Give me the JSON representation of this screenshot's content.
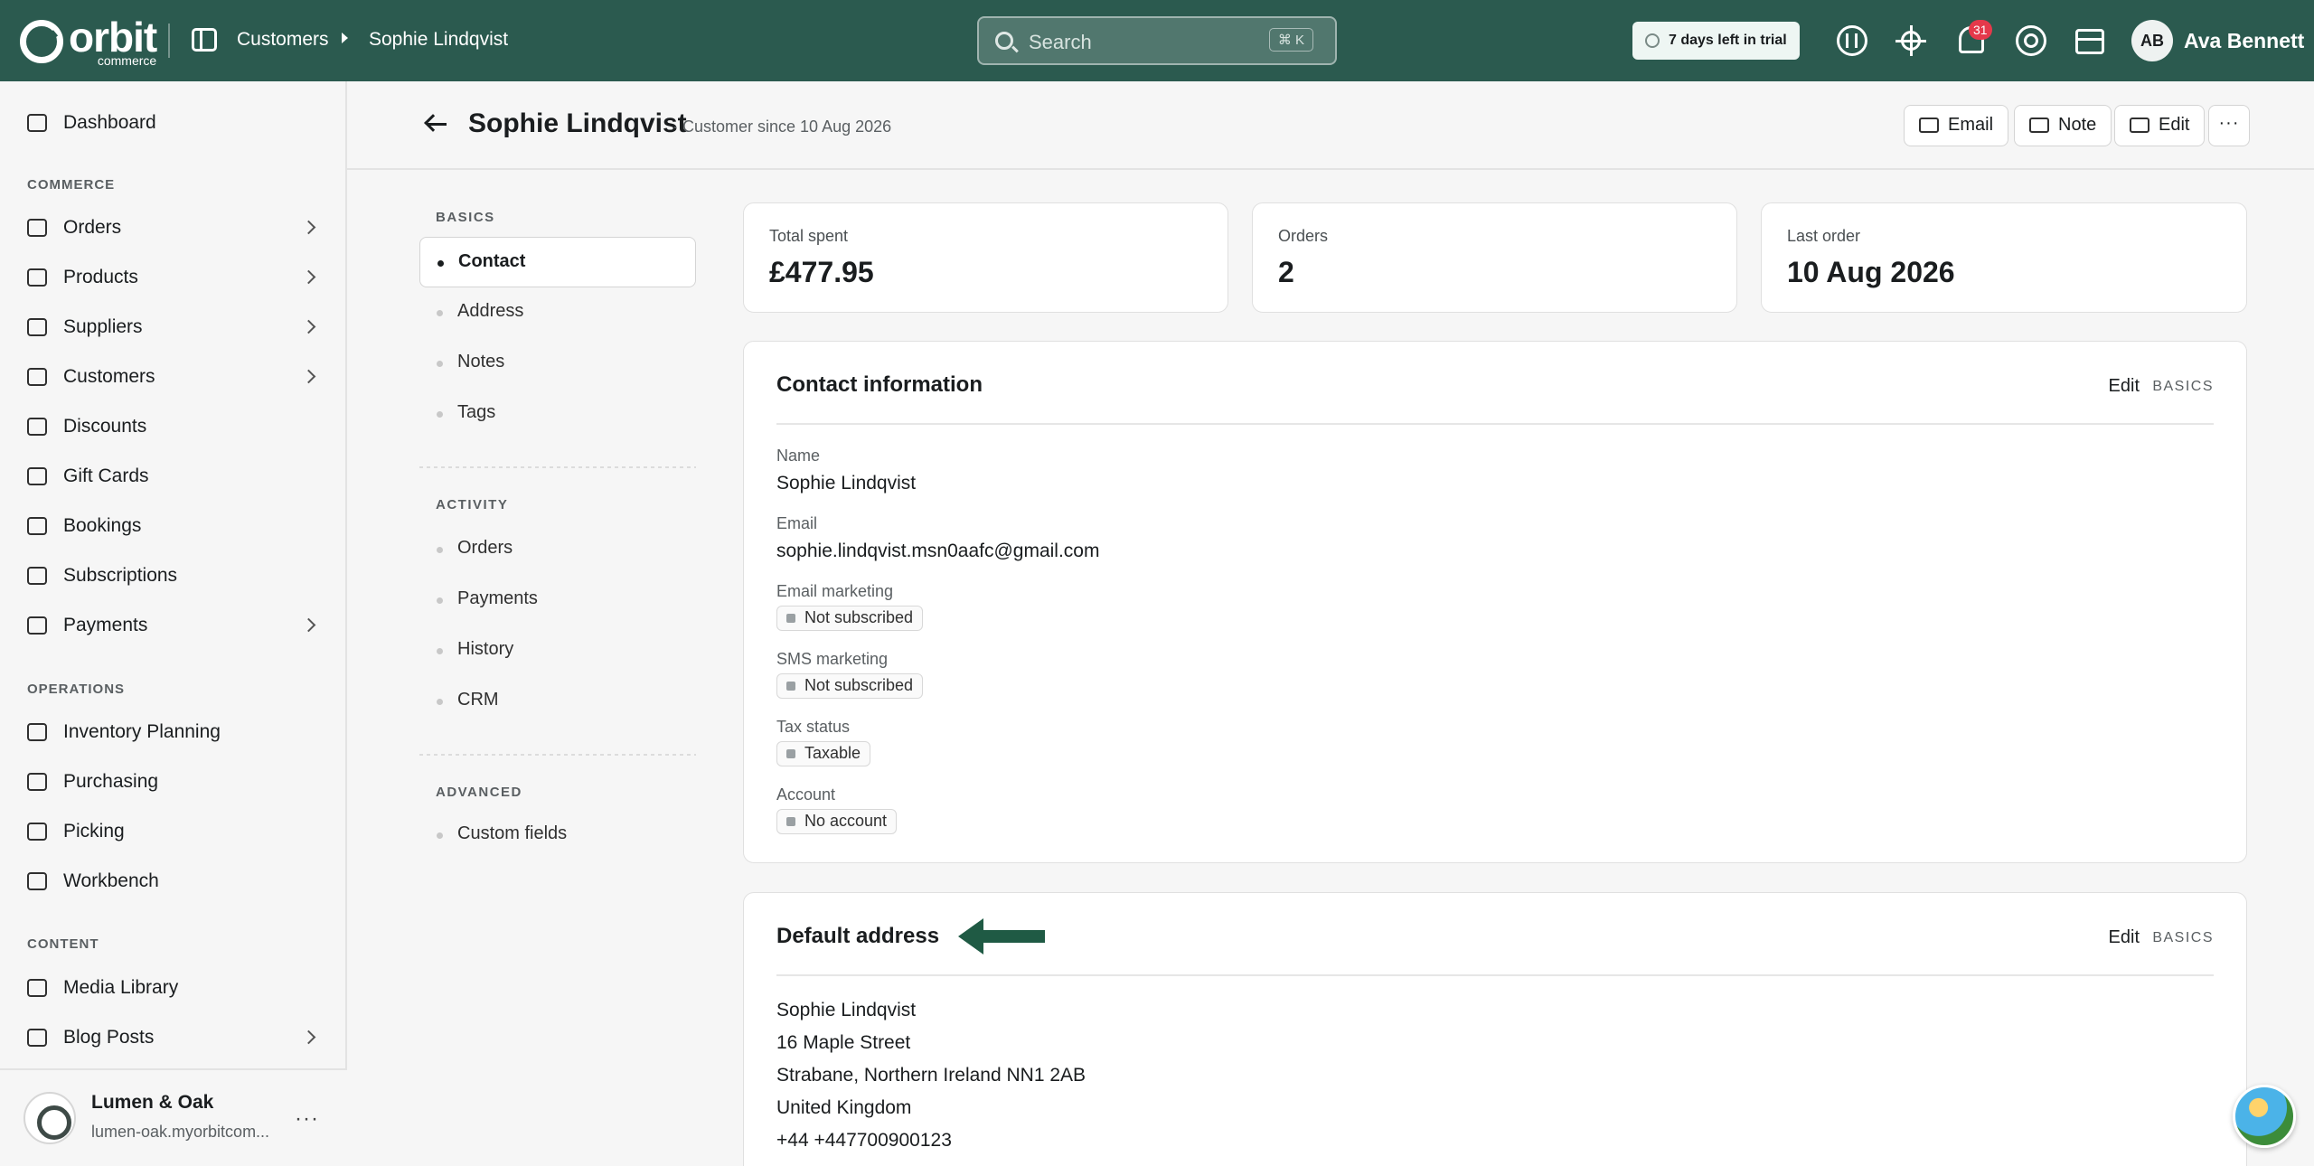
{
  "brand": {
    "name": "orbit",
    "sub": "commerce",
    "accent": "#2b5a4f"
  },
  "breadcrumb": [
    "Customers",
    "Sophie Lindqvist"
  ],
  "search": {
    "placeholder": "Search",
    "shortcut": "⌘ K"
  },
  "trial": "7 days left in trial",
  "notifications": {
    "count": "31"
  },
  "user": {
    "initials": "AB",
    "name": "Ava Bennett"
  },
  "nav": {
    "dashboard": "Dashboard",
    "commerce_heading": "COMMERCE",
    "commerce": [
      {
        "label": "Orders",
        "icon": "orders-icon",
        "chevron": true
      },
      {
        "label": "Products",
        "icon": "products-icon",
        "chevron": true
      },
      {
        "label": "Suppliers",
        "icon": "suppliers-icon",
        "chevron": true
      },
      {
        "label": "Customers",
        "icon": "customers-icon",
        "chevron": true
      },
      {
        "label": "Discounts",
        "icon": "tag-icon",
        "chevron": false
      },
      {
        "label": "Gift Cards",
        "icon": "gift-icon",
        "chevron": false
      },
      {
        "label": "Bookings",
        "icon": "calendar-icon",
        "chevron": false
      },
      {
        "label": "Subscriptions",
        "icon": "refresh-icon",
        "chevron": false
      },
      {
        "label": "Payments",
        "icon": "card-icon",
        "chevron": true
      }
    ],
    "operations_heading": "OPERATIONS",
    "operations": [
      {
        "label": "Inventory Planning",
        "icon": "clipboard-icon"
      },
      {
        "label": "Purchasing",
        "icon": "package-icon"
      },
      {
        "label": "Picking",
        "icon": "location-pin-icon"
      },
      {
        "label": "Workbench",
        "icon": "box-icon"
      }
    ],
    "content_heading": "CONTENT",
    "content": [
      {
        "label": "Media Library",
        "icon": "image-icon",
        "chevron": false
      },
      {
        "label": "Blog Posts",
        "icon": "document-icon",
        "chevron": true
      }
    ]
  },
  "store": {
    "name": "Lumen & Oak",
    "url": "lumen-oak.myorbitcom..."
  },
  "page": {
    "title": "Sophie Lindqvist",
    "subtitle": "· Customer since 10 Aug 2026",
    "actions": {
      "email": "Email",
      "note": "Note",
      "edit": "Edit",
      "more": "···"
    }
  },
  "section_nav": {
    "basics_heading": "BASICS",
    "basics": [
      "Contact",
      "Address",
      "Notes",
      "Tags"
    ],
    "activity_heading": "ACTIVITY",
    "activity": [
      "Orders",
      "Payments",
      "History",
      "CRM"
    ],
    "advanced_heading": "ADVANCED",
    "advanced": [
      "Custom fields"
    ]
  },
  "stats": [
    {
      "label": "Total spent",
      "value": "£477.95"
    },
    {
      "label": "Orders",
      "value": "2"
    },
    {
      "label": "Last order",
      "value": "10 Aug 2026"
    }
  ],
  "contact": {
    "title": "Contact information",
    "edit": "Edit",
    "tag": "BASICS",
    "name_label": "Name",
    "name": "Sophie Lindqvist",
    "email_label": "Email",
    "email": "sophie.lindqvist.msn0aafc@gmail.com",
    "email_marketing_label": "Email marketing",
    "email_marketing": "Not subscribed",
    "sms_marketing_label": "SMS marketing",
    "sms_marketing": "Not subscribed",
    "tax_label": "Tax status",
    "tax": "Taxable",
    "account_label": "Account",
    "account": "No account"
  },
  "address": {
    "title": "Default address",
    "edit": "Edit",
    "tag": "BASICS",
    "lines": [
      "Sophie Lindqvist",
      "16 Maple Street",
      "Strabane, Northern Ireland NN1 2AB",
      "United Kingdom",
      "+44 +447700900123"
    ]
  }
}
